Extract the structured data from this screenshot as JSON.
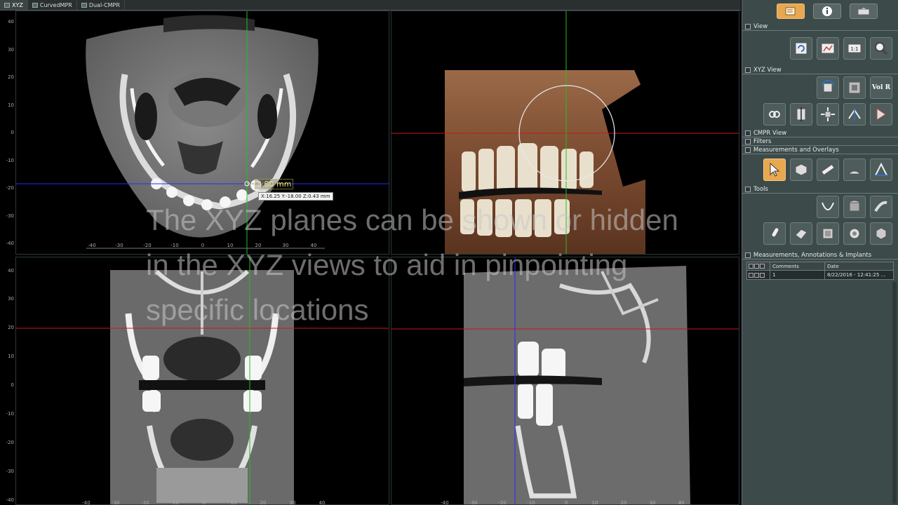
{
  "tabs": [
    {
      "label": "XYZ",
      "active": true
    },
    {
      "label": "CurvedMPR",
      "active": false
    },
    {
      "label": "Dual-CMPR",
      "active": false
    }
  ],
  "rulers": {
    "vertical_top": [
      "40",
      "30",
      "20",
      "10",
      "0",
      "-10",
      "-20",
      "-30",
      "-40"
    ],
    "vertical_bottom": [
      "40",
      "30",
      "20",
      "10",
      "0",
      "-10",
      "-20",
      "-30",
      "-40"
    ],
    "horizontal": [
      "-40",
      "-30",
      "-20",
      "-10",
      "0",
      "10",
      "20",
      "30",
      "40"
    ]
  },
  "measurement": {
    "label": "3.80 mm",
    "coords": "X:16.25 Y:-18.00 Z:0.43 mm"
  },
  "caption": "The XYZ planes can be shown or hidden in the XYZ views to aid in pinpointing specific locations",
  "panel": {
    "top_buttons": [
      "notes-icon",
      "info-icon",
      "export-icon"
    ],
    "sections": {
      "view": "View",
      "xyz_view": "XYZ View",
      "cmpr_view": "CMPR View",
      "filters": "Filters",
      "measurements_overlays": "Measurements and Overlays",
      "tools": "Tools",
      "mai": "Measurements, Annotations & Implants"
    },
    "xyz_volr": "Vol R",
    "view_one_to_one": "1:1",
    "table": {
      "headers": [
        "Comments",
        "Date"
      ],
      "rows": [
        {
          "comment": "1",
          "date": "8/22/2016 - 12:41:25 ..."
        }
      ]
    }
  },
  "colors": {
    "accent": "#e8a850",
    "crosshair_green": "#22c022",
    "crosshair_red": "#c81818",
    "crosshair_blue": "#2a2aff",
    "panel_bg": "#3d4a4a"
  }
}
